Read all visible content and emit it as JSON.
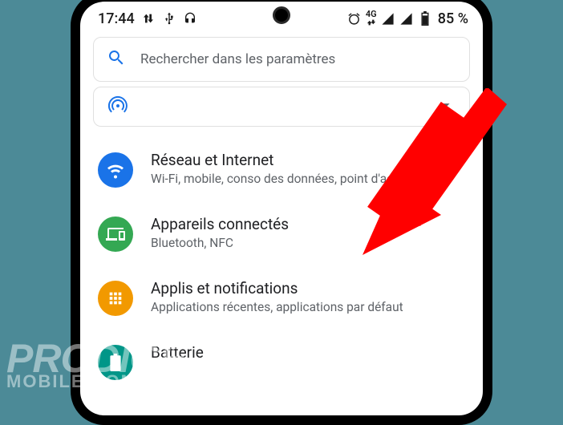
{
  "statusbar": {
    "time": "17:44",
    "network_label": "4G",
    "battery_text": "85 %"
  },
  "search": {
    "placeholder": "Rechercher dans les paramètres"
  },
  "items": [
    {
      "title": "Réseau et Internet",
      "sub": "Wi-Fi, mobile, conso des données, point d'accès"
    },
    {
      "title": "Appareils connectés",
      "sub": "Bluetooth, NFC"
    },
    {
      "title": "Applis et notifications",
      "sub": "Applications récentes, applications par défaut"
    },
    {
      "title": "Batterie",
      "sub": ""
    }
  ],
  "watermark": {
    "line1": "PRODIGE",
    "line2": "MOBILE.COM"
  }
}
